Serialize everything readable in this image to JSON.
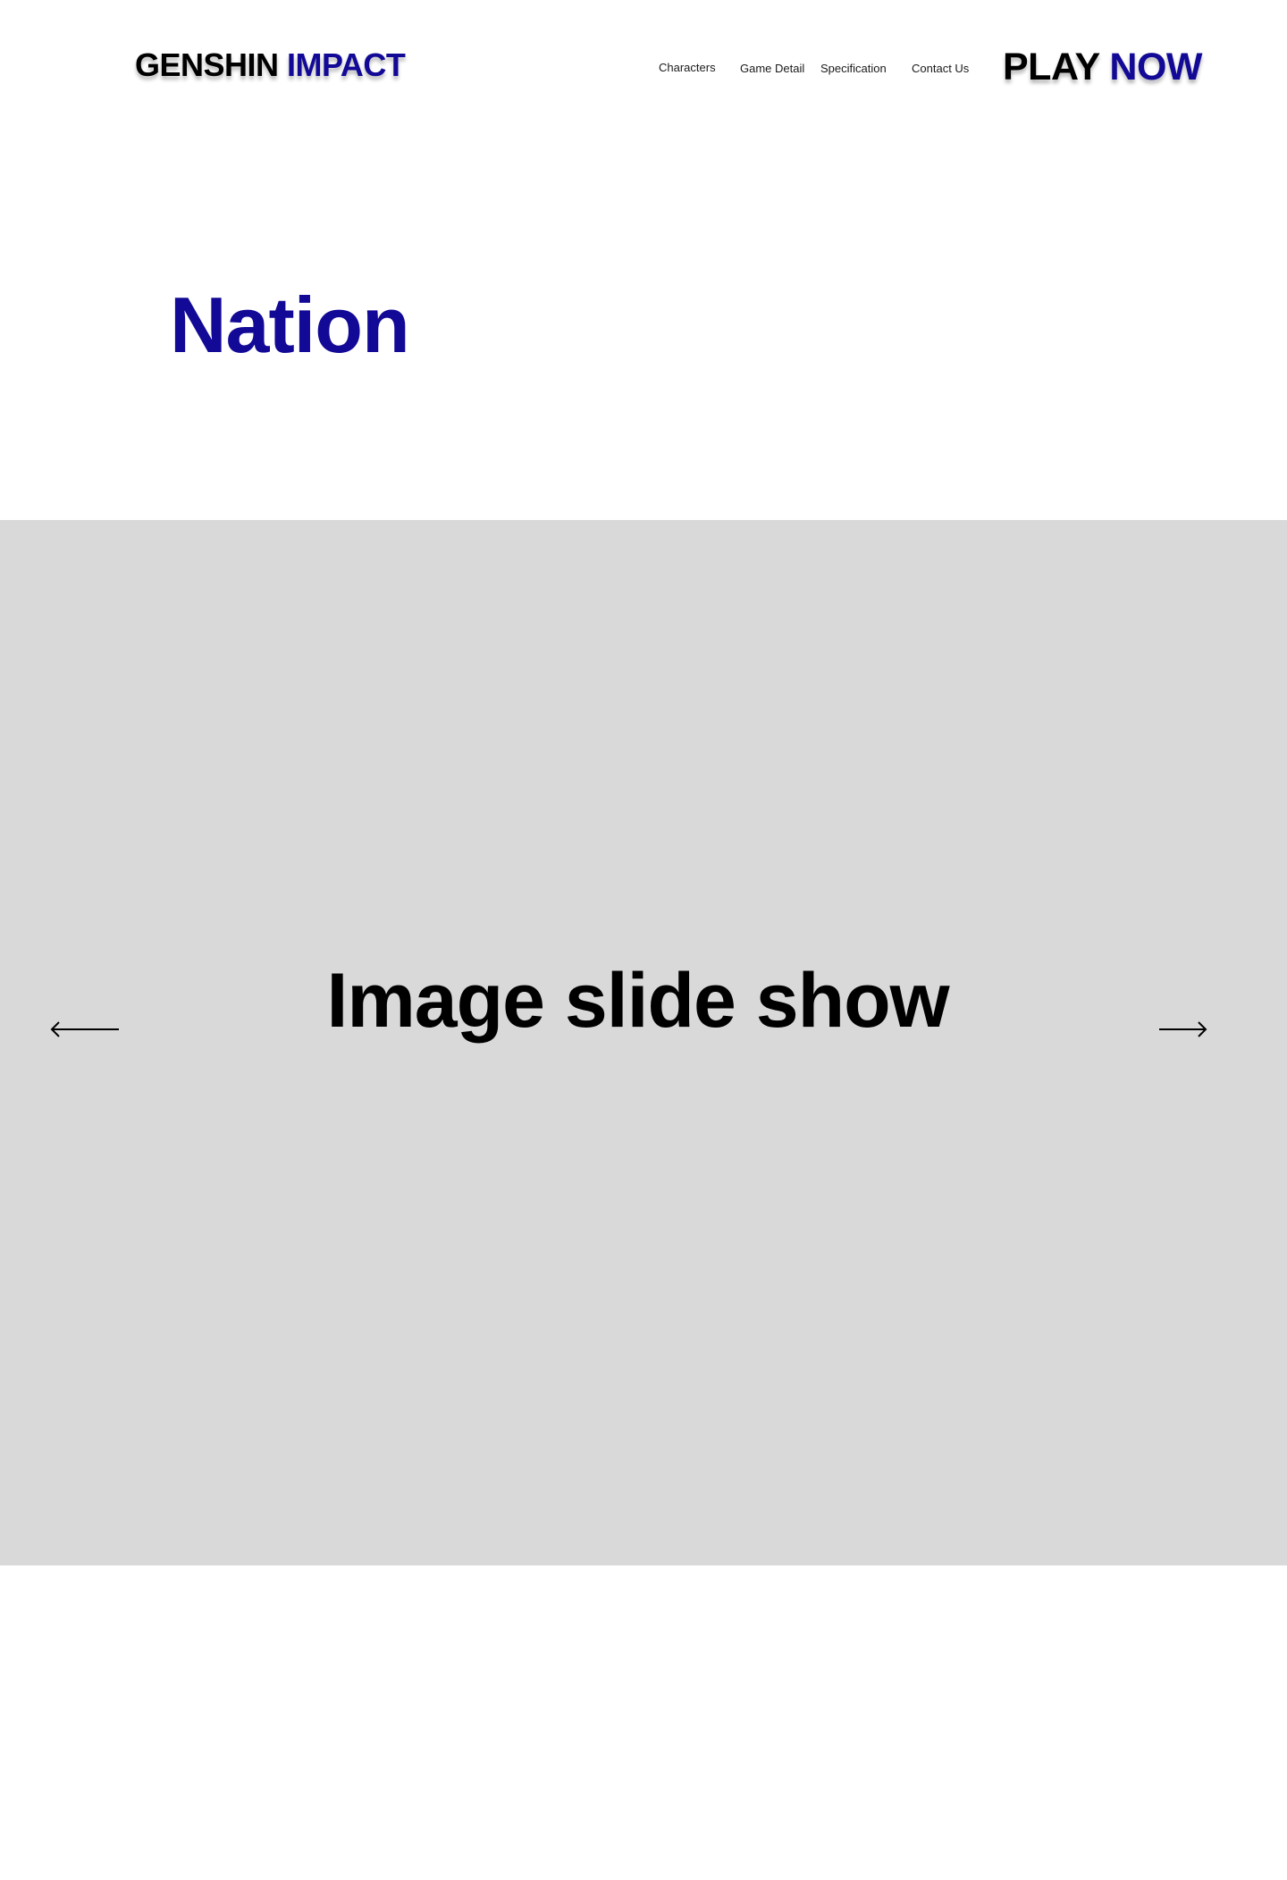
{
  "header": {
    "logo": {
      "part1": "GENSHIN",
      "part2": "IMPACT"
    },
    "nav": [
      {
        "label": "Characters"
      },
      {
        "label": "Game Detail"
      },
      {
        "label": "Specification"
      },
      {
        "label": "Contact Us"
      }
    ],
    "cta": {
      "part1": "PLAY",
      "part2": "NOW"
    }
  },
  "hero": {
    "title": "Nation"
  },
  "slideshow": {
    "caption": "Image slide show",
    "prev_icon": "arrow-left-icon",
    "next_icon": "arrow-right-icon"
  },
  "colors": {
    "brand": "#120996",
    "text": "#000000",
    "slideshow_bg": "#d9d9d9",
    "page_bg": "#ffffff"
  }
}
